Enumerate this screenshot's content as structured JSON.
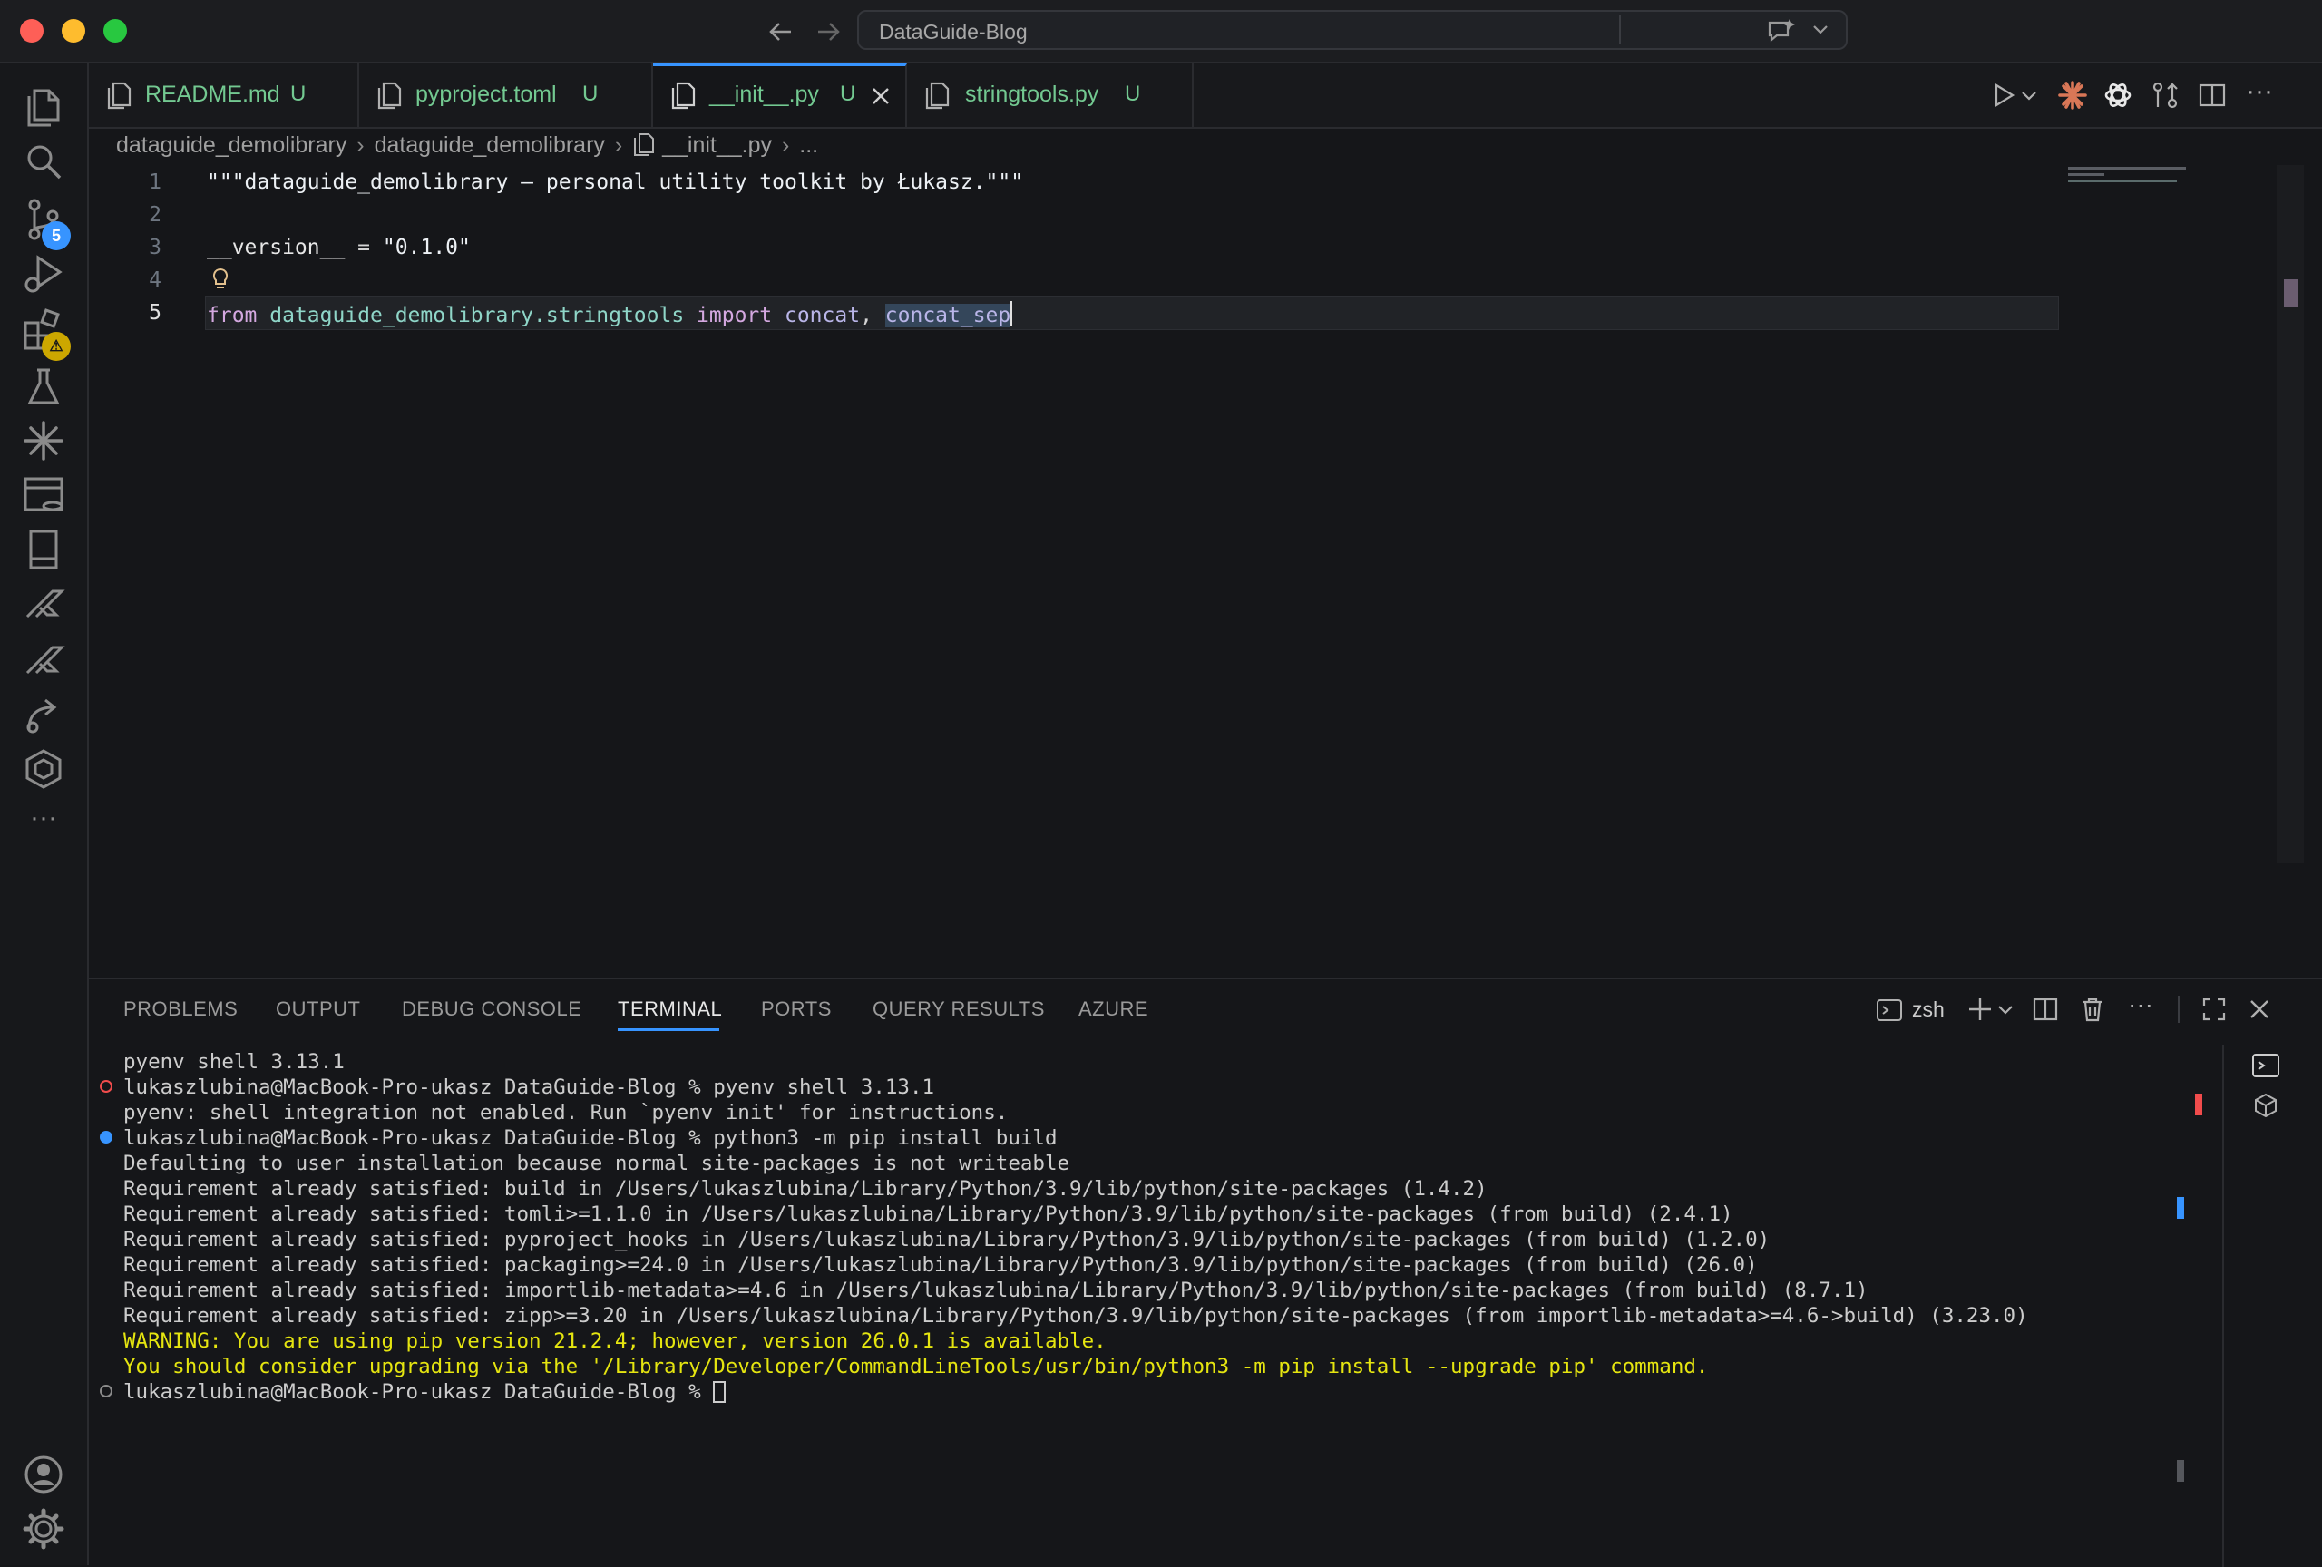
{
  "window": {
    "title": "DataGuide-Blog"
  },
  "activity_bar": {
    "source_control_badge": "5",
    "extensions_badge": "⚠"
  },
  "tabs": [
    {
      "label": "README.md",
      "status": "U",
      "active": false
    },
    {
      "label": "pyproject.toml",
      "status": "U",
      "active": false
    },
    {
      "label": "__init__.py",
      "status": "U",
      "active": true
    },
    {
      "label": "stringtools.py",
      "status": "U",
      "active": false
    }
  ],
  "breadcrumb": {
    "items": [
      "dataguide_demolibrary",
      "dataguide_demolibrary",
      "__init__.py",
      "..."
    ]
  },
  "editor": {
    "line_numbers": [
      "1",
      "2",
      "3",
      "4",
      "5"
    ],
    "lines": {
      "l1": "\"\"\"dataguide_demolibrary — personal utility toolkit by Łukasz.\"\"\"",
      "l3_name": "__version__",
      "l3_op": " = ",
      "l3_value": "\"0.1.0\"",
      "l5_kw1": "from",
      "l5_mod": " dataguide_demolibrary.stringtools ",
      "l5_kw2": "import",
      "l5_n1": " concat",
      "l5_comma": ", ",
      "l5_n2": "concat_sep"
    }
  },
  "panel": {
    "tabs": [
      "PROBLEMS",
      "OUTPUT",
      "DEBUG CONSOLE",
      "TERMINAL",
      "PORTS",
      "QUERY RESULTS",
      "AZURE"
    ],
    "active_tab": "TERMINAL",
    "shell": "zsh",
    "terminal_lines": [
      "pyenv shell 3.13.1",
      "lukaszlubina@MacBook-Pro-ukasz DataGuide-Blog % pyenv shell 3.13.1",
      "pyenv: shell integration not enabled. Run `pyenv init' for instructions.",
      "lukaszlubina@MacBook-Pro-ukasz DataGuide-Blog % python3 -m pip install build",
      "Defaulting to user installation because normal site-packages is not writeable",
      "Requirement already satisfied: build in /Users/lukaszlubina/Library/Python/3.9/lib/python/site-packages (1.4.2)",
      "Requirement already satisfied: tomli>=1.1.0 in /Users/lukaszlubina/Library/Python/3.9/lib/python/site-packages (from build) (2.4.1)",
      "Requirement already satisfied: pyproject_hooks in /Users/lukaszlubina/Library/Python/3.9/lib/python/site-packages (from build) (1.2.0)",
      "Requirement already satisfied: packaging>=24.0 in /Users/lukaszlubina/Library/Python/3.9/lib/python/site-packages (from build) (26.0)",
      "Requirement already satisfied: importlib-metadata>=4.6 in /Users/lukaszlubina/Library/Python/3.9/lib/python/site-packages (from build) (8.7.1)",
      "Requirement already satisfied: zipp>=3.20 in /Users/lukaszlubina/Library/Python/3.9/lib/python/site-packages (from importlib-metadata>=4.6->build) (3.23.0)",
      "WARNING: You are using pip version 21.2.4; however, version 26.0.1 is available.",
      "You should consider upgrading via the '/Library/Developer/CommandLineTools/usr/bin/python3 -m pip install --upgrade pip' command.",
      "lukaszlubina@MacBook-Pro-ukasz DataGuide-Blog % "
    ]
  },
  "colors": {
    "accent": "#3794ff",
    "untracked": "#73c991",
    "warning_text": "#e5e510",
    "error_dot": "#f14c4c",
    "badge_blue": "#3794ff",
    "badge_yellow": "#cca700"
  }
}
